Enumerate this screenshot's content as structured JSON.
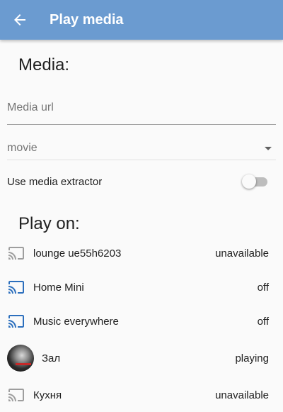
{
  "appbar": {
    "title": "Play media"
  },
  "media": {
    "heading": "Media:",
    "url_placeholder": "Media url",
    "url_value": "",
    "type_value": "movie",
    "extractor_label": "Use media extractor",
    "extractor_on": false
  },
  "play_on": {
    "heading": "Play on:",
    "players": [
      {
        "name": "lounge ue55h6203",
        "state": "unavailable",
        "icon": "cast-icon",
        "available": false
      },
      {
        "name": "Home Mini",
        "state": "off",
        "icon": "cast-icon",
        "available": true
      },
      {
        "name": "Music everywhere",
        "state": "off",
        "icon": "cast-icon",
        "available": true
      },
      {
        "name": "Зал",
        "state": "playing",
        "icon": "album-art",
        "available": true
      },
      {
        "name": "Кухня",
        "state": "unavailable",
        "icon": "cast-icon",
        "available": false
      }
    ]
  },
  "colors": {
    "appbar": "#6b9bd0",
    "cast_active": "#2c6fbd",
    "cast_inactive": "#9e9e9e"
  }
}
